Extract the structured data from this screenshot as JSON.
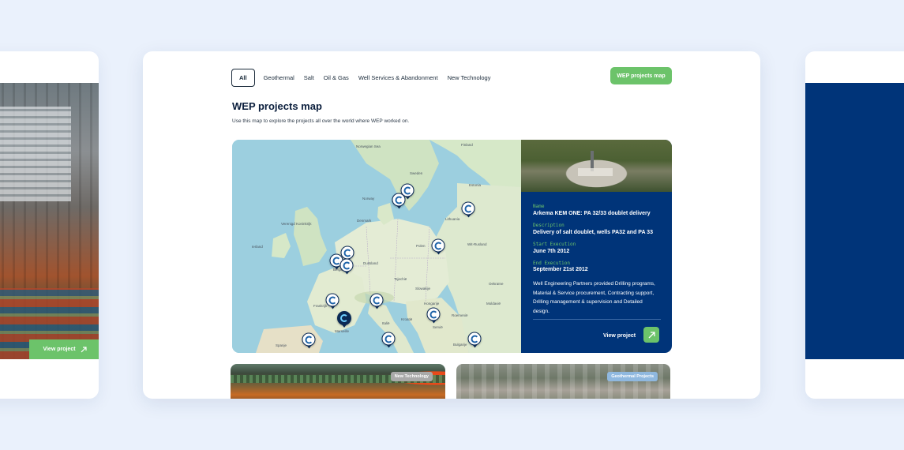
{
  "filters": [
    {
      "label": "All",
      "active": true
    },
    {
      "label": "Geothermal",
      "active": false
    },
    {
      "label": "Salt",
      "active": false
    },
    {
      "label": "Oil & Gas",
      "active": false
    },
    {
      "label": "Well Services & Abandonment",
      "active": false
    },
    {
      "label": "New Technology",
      "active": false
    }
  ],
  "header": {
    "map_button": "WEP projects map",
    "title": "WEP projects map",
    "subtitle": "Use this map to explore the projects all over the world where WEP worked on."
  },
  "map": {
    "labels": {
      "norwegian_sea": "Norwegian Sea",
      "finland": "Finland",
      "sweden": "Sweden",
      "norway": "Norway",
      "estonia": "Estonia",
      "denmark": "Denmark",
      "lithuania": "Lithuania",
      "united_kingdom": "Verenigd Koninkrijk",
      "ireland": "Ierland",
      "poland": "Polen",
      "belarus": "Wit-Rusland",
      "germany": "Duitsland",
      "belgium": "België",
      "czechia": "Tsjechië",
      "ukraine": "Oekraïne",
      "slovakia": "Slowakije",
      "france": "Frankrijk",
      "hungary": "Hongarije",
      "moldova": "Moldavië",
      "romania": "Roemenië",
      "italy": "Italië",
      "croatia": "Kroatië",
      "serbia": "Servië",
      "spain": "Spanje",
      "bulgaria": "Bulgarije",
      "marseille": "Marseille"
    }
  },
  "project": {
    "name_label": "Name",
    "name": "Arkema KEM ONE: PA 32/33 doublet delivery",
    "description_label": "Description",
    "description": "Delivery of salt doublet, wells PA32 and PA 33",
    "start_label": "Start Execution",
    "start": "June 7th 2012",
    "end_label": "End Execution",
    "end": "September 21st 2012",
    "summary": "Well Engineering Partners provided Drilling programs, Material & Service procurement, Contracting support, Drilling management & supervision and Detailed design.",
    "view_label": "View project"
  },
  "cards": {
    "left_view_label": "View project",
    "badge_new_technology": "New Technology",
    "badge_geothermal": "Geothermal Projects"
  },
  "colors": {
    "accent_green": "#6cc36a",
    "navy": "#003479",
    "background": "#eaf1fc"
  }
}
